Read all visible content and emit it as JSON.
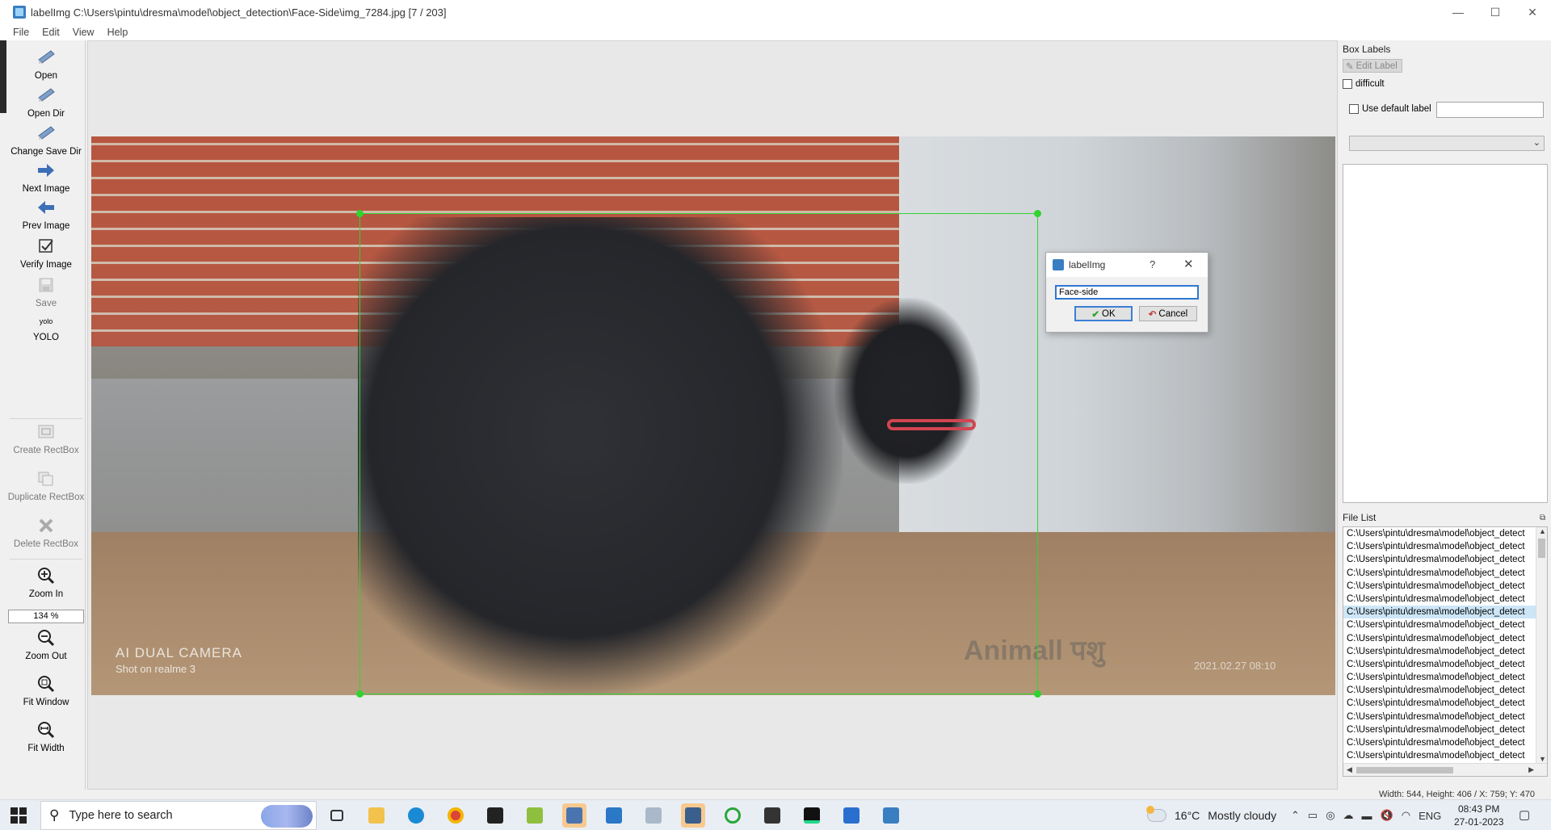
{
  "window": {
    "title": "labelImg C:\\Users\\pintu\\dresma\\model\\object_detection\\Face-Side\\img_7284.jpg [7 / 203]",
    "minimize": "—",
    "maximize": "☐",
    "close": "✕"
  },
  "menu": [
    "File",
    "Edit",
    "View",
    "Help"
  ],
  "toolbar": {
    "open": "Open",
    "open_dir": "Open Dir",
    "change_save_dir": "Change Save Dir",
    "next_image": "Next Image",
    "prev_image": "Prev Image",
    "verify_image": "Verify Image",
    "save": "Save",
    "yolo_icon": "yolo",
    "yolo": "YOLO",
    "create_rectbox": "Create RectBox",
    "duplicate_rectbox": "Duplicate RectBox",
    "delete_rectbox": "Delete RectBox",
    "zoom_in": "Zoom In",
    "zoom_value": "134 %",
    "zoom_out": "Zoom Out",
    "fit_window": "Fit Window",
    "fit_width": "Fit Width"
  },
  "photo": {
    "watermark_camera": "AI DUAL CAMERA",
    "watermark_shot": "Shot on realme 3",
    "watermark_brand": "Animall पशु",
    "watermark_date": "2021.02.27 08:10"
  },
  "dialog": {
    "title": "labelImg",
    "help": "?",
    "close": "✕",
    "input_value": "Face-side",
    "ok": "OK",
    "cancel": "Cancel"
  },
  "right_panel": {
    "box_labels_title": "Box Labels",
    "edit_label": "Edit Label",
    "difficult": "difficult",
    "use_default_label": "Use default label",
    "file_list_title": "File List",
    "files": [
      "C:\\Users\\pintu\\dresma\\model\\object_detect",
      "C:\\Users\\pintu\\dresma\\model\\object_detect",
      "C:\\Users\\pintu\\dresma\\model\\object_detect",
      "C:\\Users\\pintu\\dresma\\model\\object_detect",
      "C:\\Users\\pintu\\dresma\\model\\object_detect",
      "C:\\Users\\pintu\\dresma\\model\\object_detect",
      "C:\\Users\\pintu\\dresma\\model\\object_detect",
      "C:\\Users\\pintu\\dresma\\model\\object_detect",
      "C:\\Users\\pintu\\dresma\\model\\object_detect",
      "C:\\Users\\pintu\\dresma\\model\\object_detect",
      "C:\\Users\\pintu\\dresma\\model\\object_detect",
      "C:\\Users\\pintu\\dresma\\model\\object_detect",
      "C:\\Users\\pintu\\dresma\\model\\object_detect",
      "C:\\Users\\pintu\\dresma\\model\\object_detect",
      "C:\\Users\\pintu\\dresma\\model\\object_detect",
      "C:\\Users\\pintu\\dresma\\model\\object_detect",
      "C:\\Users\\pintu\\dresma\\model\\object_detect",
      "C:\\Users\\pintu\\dresma\\model\\object_detect"
    ],
    "selected_file_index": 6
  },
  "statusbar": {
    "text": "Width: 544, Height: 406 / X: 759; Y: 470"
  },
  "taskbar": {
    "search_placeholder": "Type here to search",
    "weather_temp": "16°C",
    "weather_desc": "Mostly cloudy",
    "language": "ENG",
    "time": "08:43 PM",
    "date": "27-01-2023"
  },
  "colors": {
    "bbox": "#34d234",
    "dialog_focus": "#2f77d3",
    "selected_row": "#cde6f7",
    "taskbar_active": "#f7c98f"
  }
}
